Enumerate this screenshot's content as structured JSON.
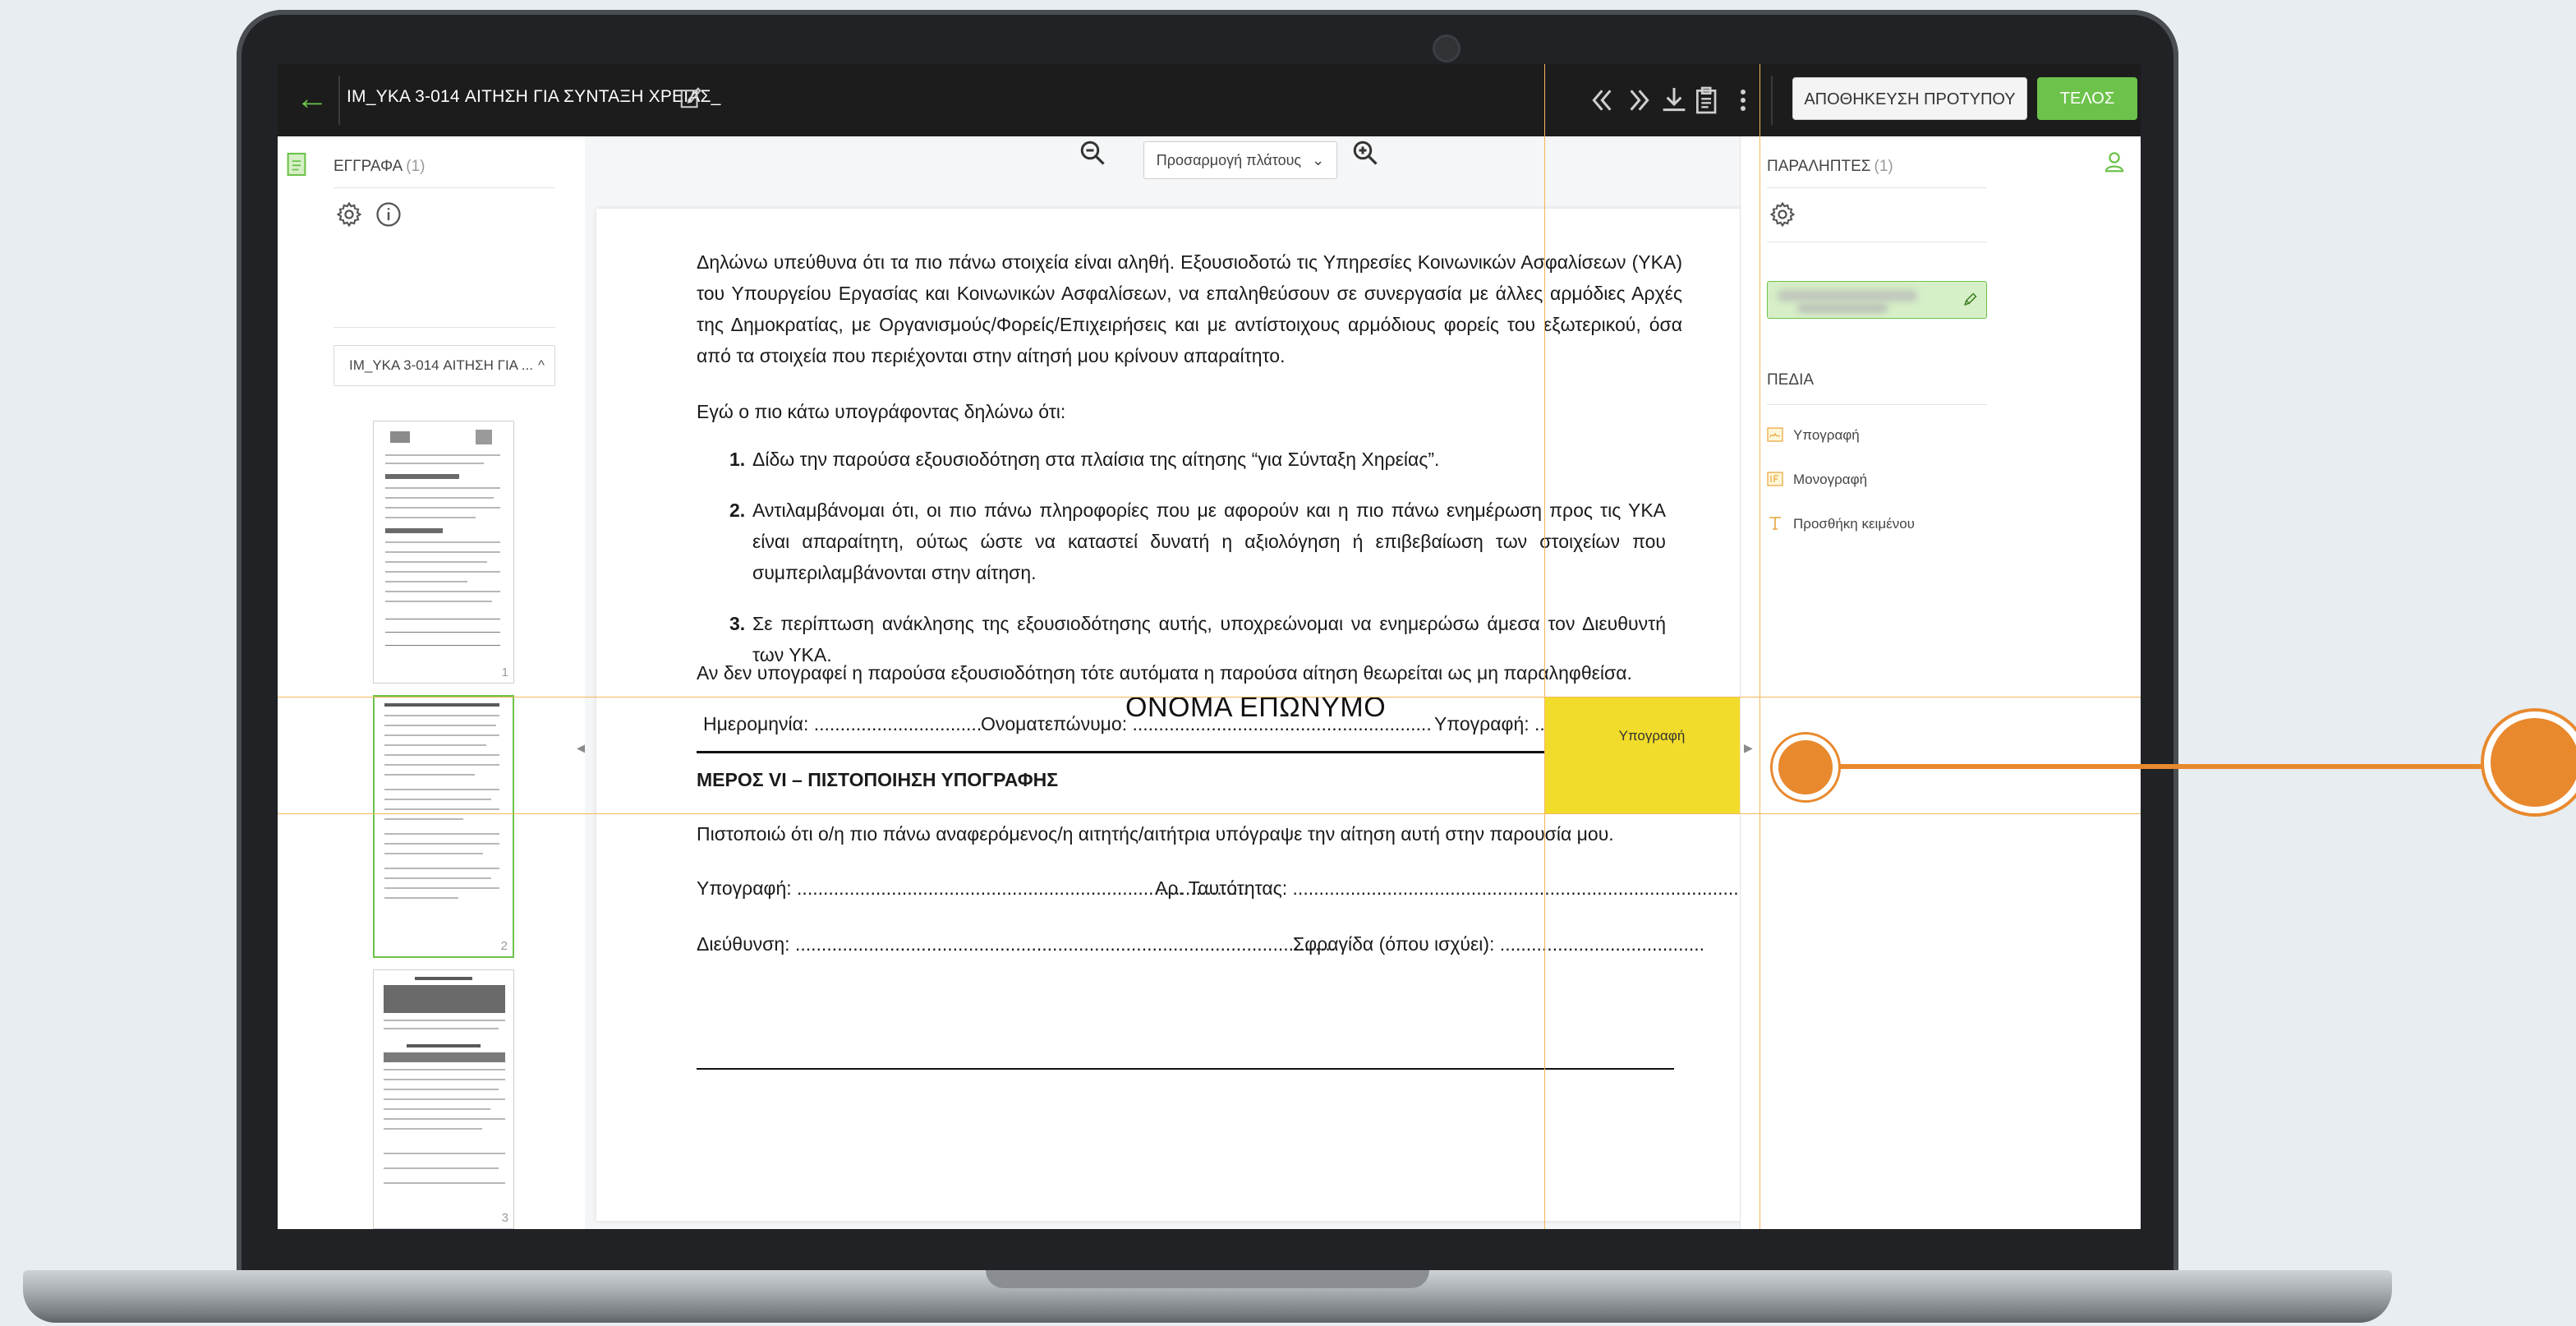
{
  "topbar": {
    "doc_title": "IM_YKA 3-014 ΑΙΤΗΣΗ ΓΙΑ ΣΥΝΤΑΞΗ ΧΡΕΙΑΣ_",
    "save_template_label": "ΑΠΟΘΗΚΕΥΣΗ ΠΡΟΤΥΠΟΥ",
    "done_label": "ΤΕΛΟΣ",
    "icons": [
      "back-arrow-icon",
      "edit-icon",
      "previous-page-icon",
      "next-page-icon",
      "download-icon",
      "clipboard-icon",
      "more-vertical-icon"
    ]
  },
  "left_panel": {
    "title": "ΕΓΓΡΑΦΑ",
    "count": "(1)",
    "document_select": "IM_YKA 3-014 ΑΙΤΗΣΗ ΓΙΑ ...",
    "thumbnails": [
      "1",
      "2",
      "3"
    ]
  },
  "toolbar": {
    "zoom_label": "Προσαρμογή πλάτους"
  },
  "document": {
    "intro": "Δηλώνω υπεύθυνα ότι τα πιο πάνω στοιχεία είναι αληθή. Εξουσιοδοτώ τις Υπηρεσίες Κοινωνικών Ασφαλίσεων (ΥΚΑ) του Υπουργείου Εργασίας και Κοινωνικών Ασφαλίσεων, να επαληθεύσουν σε συνεργασία με άλλες αρμόδιες Αρχές της Δημοκρατίας, με Οργανισμούς/Φορείς/Επιχειρήσεις και με αντίστοιχους αρμόδιους φορείς του εξωτερικού, όσα από τα στοιχεία που περιέχονται στην αίτησή μου κρίνουν απαραίτητο.",
    "declare": "Εγώ ο πιο κάτω υπογράφοντας δηλώνω ότι:",
    "items": [
      {
        "num": "1.",
        "text": "Δίδω την παρούσα εξουσιοδότηση στα πλαίσια της αίτησης “για Σύνταξη Χηρείας”."
      },
      {
        "num": "2.",
        "text": "Αντιλαμβάνομαι ότι, οι πιο πάνω πληροφορίες που με αφορούν και η πιο πάνω ενημέρωση προς τις ΥΚΑ είναι απαραίτητη, ούτως ώστε να καταστεί δυνατή η αξιολόγηση ή επιβεβαίωση των στοιχείων που συμπεριλαμβάνονται στην αίτηση."
      },
      {
        "num": "3.",
        "text": "Σε περίπτωση ανάκλησης της εξουσιοδότησης αυτής, υποχρεώνομαι να ενημερώσω άμεσα τον Διευθυντή των ΥΚΑ."
      }
    ],
    "not_signed": "Αν δεν υπογραφεί η παρούσα εξουσιοδότηση τότε αυτόματα η παρούσα αίτηση θεωρείται ως μη παραληφθείσα.",
    "date_label": "Ημερομηνία: ................................",
    "name_label": "Ονοματεπώνυμο: .........................................................",
    "name_value": "ΟΝΟΜΑ ΕΠΩΝΥΜΟ",
    "signature_label": "Υπογραφή: ...........",
    "section_title": "ΜΕΡΟΣ VI – ΠΙΣΤΟΠΟΙΗΣΗ ΥΠΟΓΡΑΦΗΣ",
    "certify": "Πιστοποιώ ότι ο/η πιο πάνω αναφερόμενος/η αιτητής/αιτήτρια υπόγραψε την αίτηση αυτή στην παρουσία μου.",
    "sig_line": "Υπογραφή: ......................................................................................",
    "id_line": "Αρ. Ταυτότητας: ..............................................................................................",
    "address_line": "Διεύθυνση: .......................................................................................................",
    "stamp_line": "Σφραγίδα (όπου ισχύει): .......................................",
    "signature_field_label": "Υπογραφή"
  },
  "right_panel": {
    "title": "ΠΑΡΑΛΗΠΤΕΣ",
    "count": "(1)",
    "fields_title": "ΠΕΔΙΑ",
    "fields": [
      "Υπογραφή",
      "Μονογραφή",
      "Προσθήκη κειμένου"
    ]
  },
  "colors": {
    "accent_green": "#6cc24a",
    "signature_field": "#f2dc2b",
    "callout_orange": "#e8892e",
    "topbar": "#1c1c1c"
  }
}
